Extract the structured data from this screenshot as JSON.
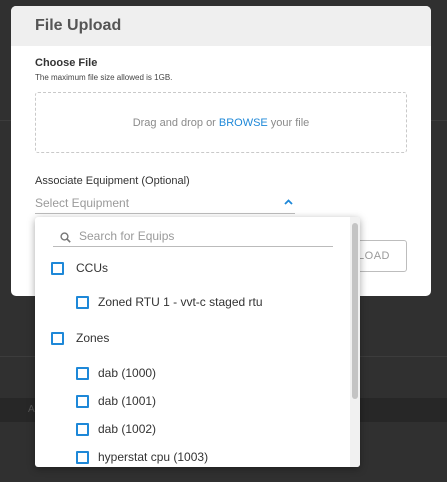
{
  "modal": {
    "title": "File Upload",
    "choose_file_label": "Choose File",
    "max_size_note": "The maximum file size allowed is 1GB.",
    "dropzone": {
      "text_before": "Drag and drop or",
      "browse_link": "BROWSE",
      "text_after": "your file"
    },
    "associate_label": "Associate Equipment (Optional)",
    "equipment_select_placeholder": "Select Equipment",
    "upload_button_visible_text": "LOAD"
  },
  "dropdown": {
    "search_placeholder": "Search for Equips",
    "groups": [
      {
        "label": "CCUs",
        "items": [
          "Zoned RTU 1 - vvt-c staged rtu"
        ]
      },
      {
        "label": "Zones",
        "items": [
          "dab (1000)",
          "dab (1001)",
          "dab (1002)",
          "hyperstat cpu (1003)"
        ]
      }
    ]
  },
  "colors": {
    "accent": "#1e88d8",
    "modal_header_bg": "#efefef",
    "overlay": "rgba(0,0,0,0.78)"
  }
}
